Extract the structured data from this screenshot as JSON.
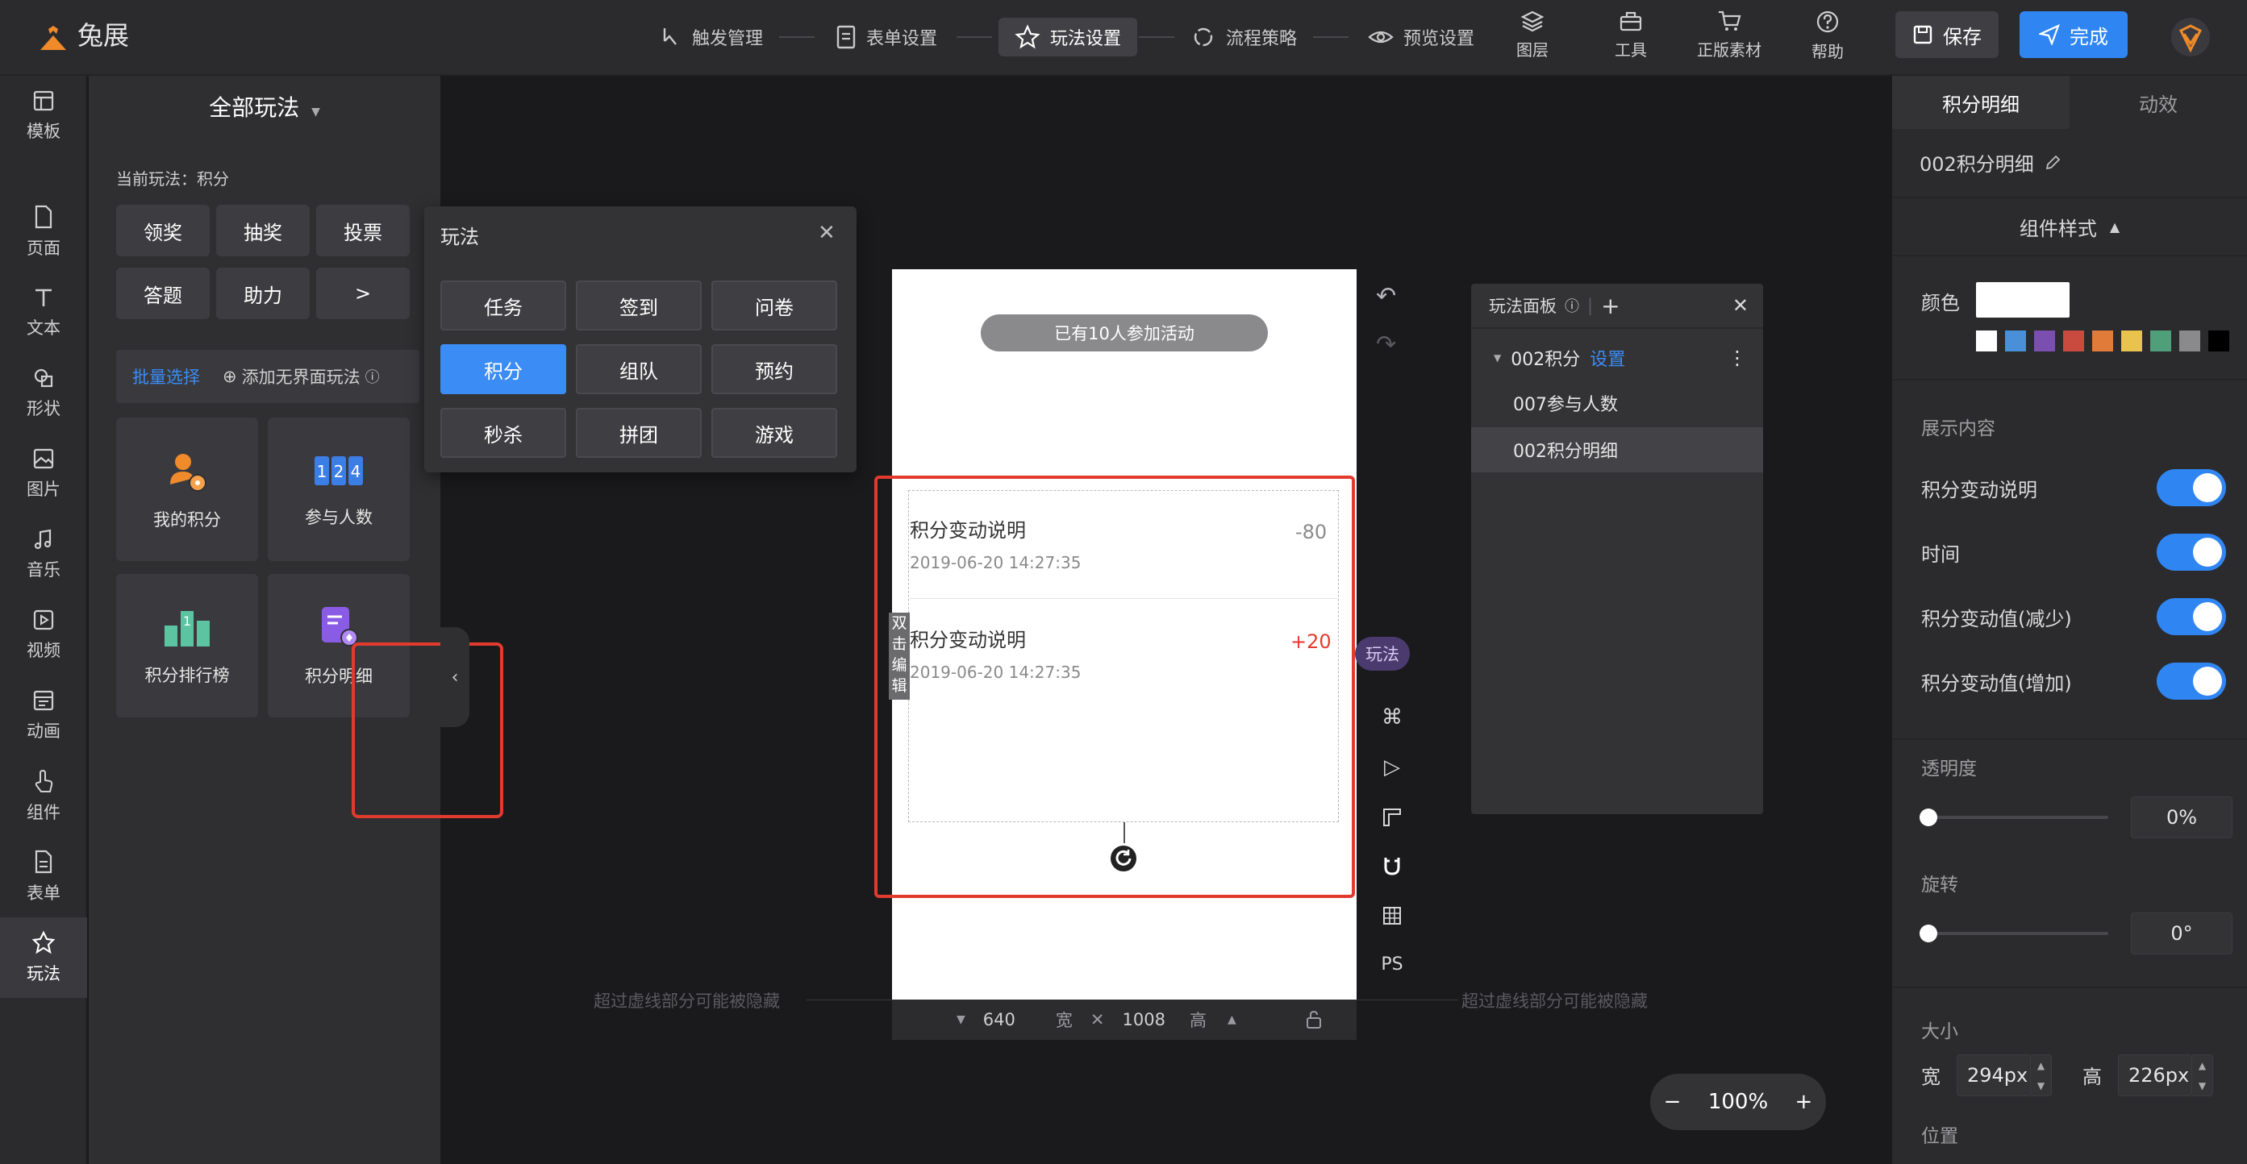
{
  "app": {
    "logo_text": "兔展",
    "brand_color": "#f08a2a"
  },
  "steps": [
    {
      "label": "触发管理",
      "icon": "hand-pointer-icon"
    },
    {
      "label": "表单设置",
      "icon": "form-icon"
    },
    {
      "label": "玩法设置",
      "icon": "star-icon",
      "active": true
    },
    {
      "label": "流程策略",
      "icon": "flow-icon"
    },
    {
      "label": "预览设置",
      "icon": "eye-icon"
    }
  ],
  "tools": [
    {
      "label": "图层",
      "icon": "layers-icon"
    },
    {
      "label": "工具",
      "icon": "toolbox-icon"
    },
    {
      "label": "正版素材",
      "icon": "cart-icon"
    },
    {
      "label": "帮助",
      "icon": "help-icon"
    }
  ],
  "actions": {
    "save": "保存",
    "done": "完成"
  },
  "leftnav": [
    {
      "label": "模板",
      "icon": "template-icon"
    },
    {
      "label": "页面",
      "icon": "page-icon"
    },
    {
      "label": "文本",
      "icon": "text-icon"
    },
    {
      "label": "形状",
      "icon": "shape-icon"
    },
    {
      "label": "图片",
      "icon": "image-icon"
    },
    {
      "label": "音乐",
      "icon": "music-icon"
    },
    {
      "label": "视频",
      "icon": "video-icon"
    },
    {
      "label": "动画",
      "icon": "animation-icon"
    },
    {
      "label": "组件",
      "icon": "component-icon"
    },
    {
      "label": "表单",
      "icon": "form-icon"
    },
    {
      "label": "玩法",
      "icon": "play-icon",
      "active": true
    }
  ],
  "leftpanel": {
    "title": "全部玩法",
    "current": "当前玩法：积分",
    "categories": [
      "领奖",
      "抽奖",
      "投票",
      "答题",
      "助力",
      ">"
    ],
    "batch_select": "批量选择",
    "add_play": "添加无界面玩法",
    "cards": [
      {
        "label": "我的积分",
        "icon": "my-points-icon"
      },
      {
        "label": "参与人数",
        "icon": "counter-icon"
      },
      {
        "label": "积分排行榜",
        "icon": "leaderboard-icon"
      },
      {
        "label": "积分明细",
        "icon": "points-detail-icon",
        "selected": true
      }
    ]
  },
  "popover": {
    "title": "玩法",
    "items": [
      "任务",
      "签到",
      "问卷",
      "积分",
      "组队",
      "预约",
      "秒杀",
      "拼团",
      "游戏"
    ],
    "active": "积分"
  },
  "canvas": {
    "participants_pill": "已有10人参加活动",
    "rows": [
      {
        "title": "积分变动说明",
        "date": "2019-06-20 14:27:35",
        "value": "-80"
      },
      {
        "title": "积分变动说明",
        "date": "2019-06-20 14:27:35",
        "value": "+20"
      }
    ],
    "dbl_edit": "双击编辑",
    "hide_hint": "超过虚线部分可能被隐藏",
    "width": "640",
    "width_label": "宽",
    "height": "1008",
    "height_label": "高",
    "play_badge": "玩法",
    "ps_label": "PS",
    "zoom": "100%"
  },
  "playpanel": {
    "title": "玩法面板",
    "group": "002积分",
    "group_link": "设置",
    "items": [
      "007参与人数",
      "002积分明细"
    ],
    "selected": "002积分明细"
  },
  "rightpanel": {
    "tabs": [
      "积分明细",
      "动效"
    ],
    "component_name": "002积分明细",
    "style_header": "组件样式",
    "color_label": "颜色",
    "swatches": [
      "#ffffff",
      "#4a90d9",
      "#7a4fb0",
      "#c94b3f",
      "#e07b39",
      "#e8c44f",
      "#4fa07a",
      "#8a8a8d",
      "#000000"
    ],
    "content_label": "展示内容",
    "toggles": [
      "积分变动说明",
      "时间",
      "积分变动值(减少)",
      "积分变动值(增加)"
    ],
    "opacity_label": "透明度",
    "opacity_value": "0%",
    "rotate_label": "旋转",
    "rotate_value": "0°",
    "size_label": "大小",
    "width_label": "宽",
    "width_value": "294px",
    "height_label": "高",
    "height_value": "226px",
    "position_label": "位置"
  }
}
